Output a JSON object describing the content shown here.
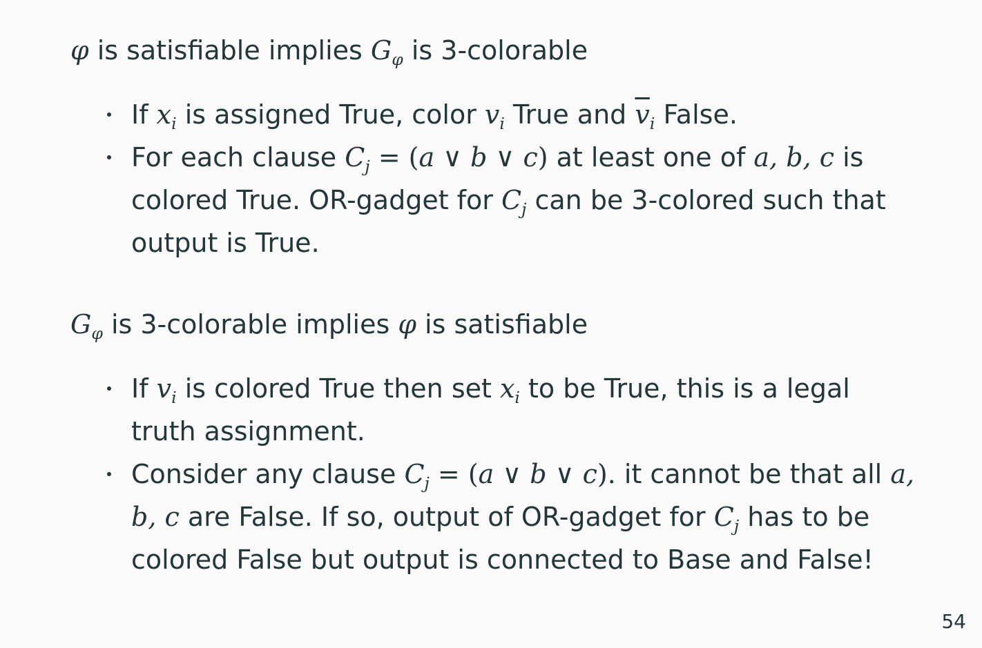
{
  "section1": {
    "heading": {
      "phi": "φ",
      "t1": " is satisfiable implies ",
      "G": "G",
      "Gsub": "φ",
      "t2": " is 3-colorable"
    },
    "bullet1": {
      "t1": "If ",
      "x": "x",
      "xsub": "i",
      "t2": " is assigned True, color ",
      "v": "v",
      "vsub": "i",
      "t3": " True and ",
      "vbar": "v",
      "vbarsub": "i",
      "t4": " False."
    },
    "bullet2": {
      "t1": "For each clause ",
      "C": "C",
      "Csub": "j",
      "eq": " = (",
      "a": "a",
      "or1": " ∨ ",
      "b": "b",
      "or2": " ∨ ",
      "c": "c",
      "close": ")",
      "t2": " at least one of ",
      "abc": "a, b, c",
      "t3": " is colored True. OR-gadget for ",
      "C2": "C",
      "C2sub": "j",
      "t4": " can be 3-colored such that output is True."
    }
  },
  "section2": {
    "heading": {
      "G": "G",
      "Gsub": "φ",
      "t1": " is 3-colorable implies ",
      "phi": "φ",
      "t2": " is satisfiable"
    },
    "bullet1": {
      "t1": "If ",
      "v": "v",
      "vsub": "i",
      "t2": " is colored True then set ",
      "x": "x",
      "xsub": "i",
      "t3": " to be True, this is a legal truth assignment."
    },
    "bullet2": {
      "t1": "Consider any clause ",
      "C": "C",
      "Csub": "j",
      "eq": " = (",
      "a": "a",
      "or1": " ∨ ",
      "b": "b",
      "or2": " ∨ ",
      "c": "c",
      "close": ").",
      "t2": " it cannot be that all ",
      "abc": "a, b, c",
      "t3": " are False. If so, output of OR-gadget for ",
      "C2": "C",
      "C2sub": "j",
      "t4": " has to be colored False but output is connected to Base and False!"
    }
  },
  "page_number": "54"
}
